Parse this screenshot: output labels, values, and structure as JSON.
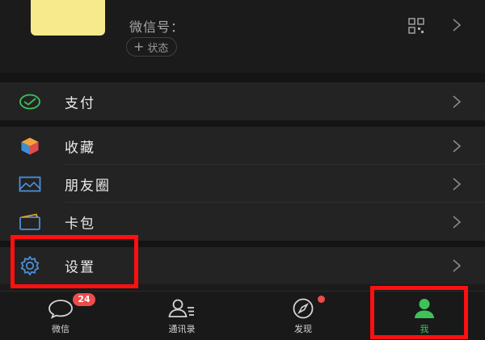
{
  "profile": {
    "wechat_id_label": "微信号：",
    "status_label": "状态",
    "status_plus": "+"
  },
  "menu": {
    "pay": {
      "label": "支付",
      "icon": "pay-icon"
    },
    "favorites": {
      "label": "收藏",
      "icon": "favorites-cube-icon"
    },
    "moments": {
      "label": "朋友圈",
      "icon": "moments-picture-icon"
    },
    "cards": {
      "label": "卡包",
      "icon": "card-wallet-icon"
    },
    "settings": {
      "label": "设置",
      "icon": "gear-icon"
    }
  },
  "tabbar": {
    "chats": {
      "label": "微信",
      "badge": "24",
      "icon": "chat-bubble-icon"
    },
    "contacts": {
      "label": "通讯录",
      "icon": "contacts-icon"
    },
    "discover": {
      "label": "发现",
      "icon": "compass-icon"
    },
    "me": {
      "label": "我",
      "icon": "person-icon"
    }
  },
  "colors": {
    "background": "#1b1b1b",
    "cell": "#232323",
    "accent_green": "#3fc15a",
    "badge_red": "#ee4b4b",
    "annotation_red": "#ff1010"
  }
}
